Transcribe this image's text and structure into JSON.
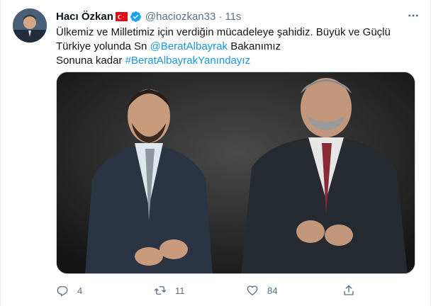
{
  "tweet": {
    "author_name": "Hacı Özkan",
    "handle": "@haciozkan33",
    "separator": "·",
    "time": "11s",
    "text_line1": "Ülkemiz ve Milletimiz için verdiğin mücadeleye şahidiz. Büyük ve Güçlü",
    "text_line2_prefix": "Türkiye yolunda Sn ",
    "mention": "@BeratAlbayrak",
    "text_line2_suffix": " Bakanımız",
    "text_line3_prefix": "Sonuna kadar ",
    "hashtag": "#BeratAlbayrakYanındayız"
  },
  "actions": {
    "reply_count": "4",
    "retweet_count": "11",
    "like_count": "84"
  },
  "colors": {
    "link": "#1b95e0",
    "secondary_text": "#5b7083",
    "verified": "#1da1f2",
    "flag": "#e30a17"
  },
  "icons": [
    "more-icon",
    "verified-badge-icon",
    "turkey-flag-icon",
    "reply-icon",
    "retweet-icon",
    "like-icon",
    "share-icon"
  ]
}
